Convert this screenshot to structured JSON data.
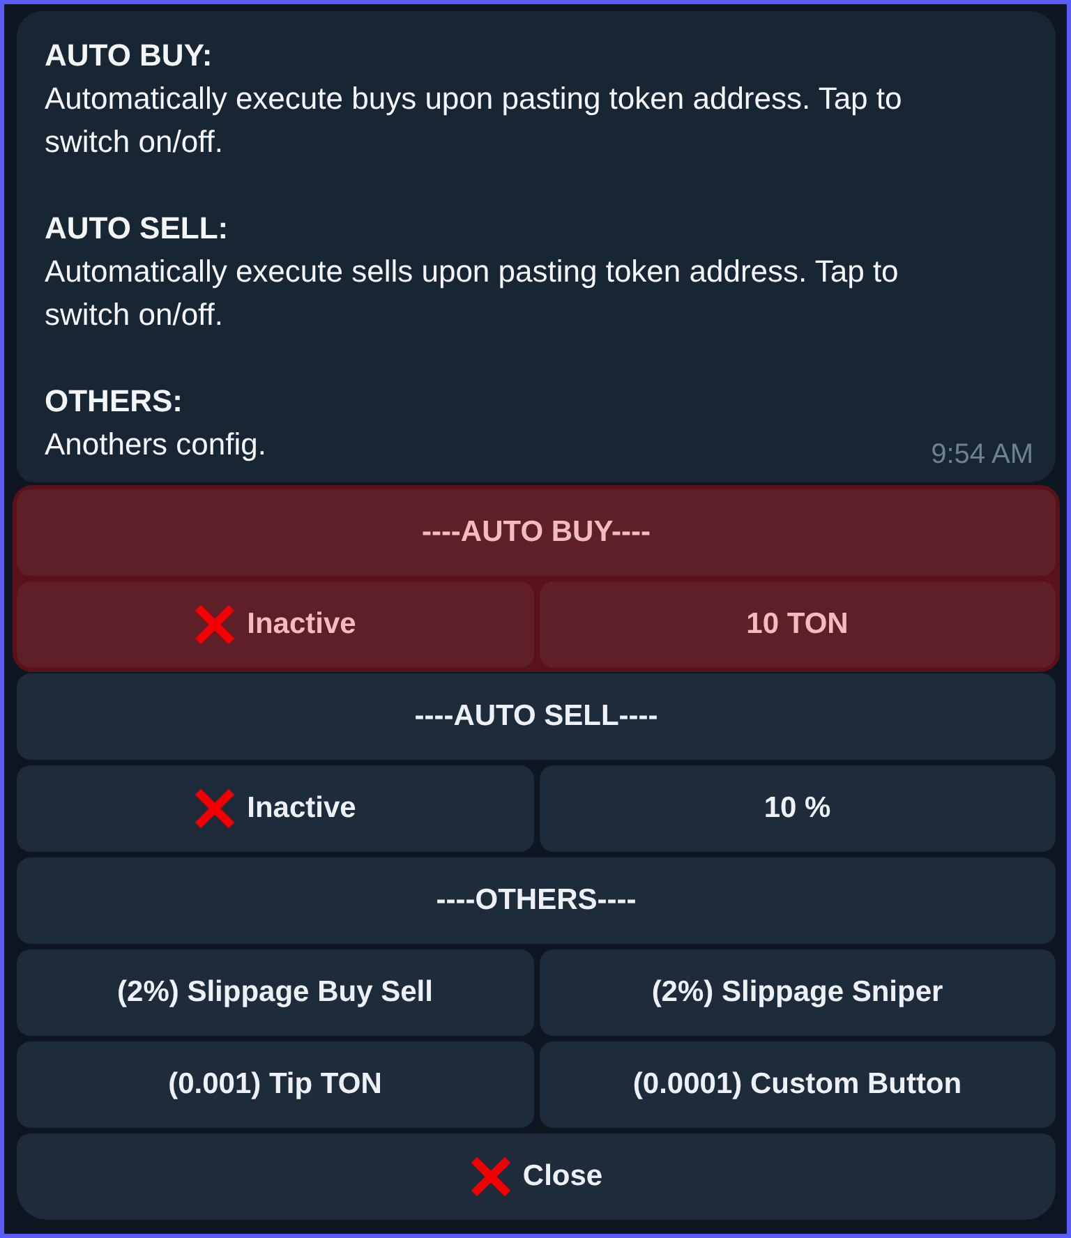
{
  "message": {
    "paragraphs": [
      {
        "heading": "AUTO BUY:",
        "body": "Automatically execute buys upon pasting token address. Tap to switch on/off."
      },
      {
        "heading": "AUTO SELL:",
        "body": "Automatically execute sells upon pasting token address. Tap to switch on/off."
      },
      {
        "heading": "OTHERS:",
        "body": "Anothers config."
      }
    ],
    "time": "9:54 AM"
  },
  "keyboard": {
    "sections": [
      {
        "highlighted": true,
        "rows": [
          [
            {
              "kind": "text",
              "label": "----AUTO BUY----"
            }
          ],
          [
            {
              "kind": "cross",
              "label": "Inactive"
            },
            {
              "kind": "text",
              "label": "10 TON"
            }
          ]
        ]
      },
      {
        "highlighted": false,
        "rows": [
          [
            {
              "kind": "text",
              "label": "----AUTO SELL----"
            }
          ],
          [
            {
              "kind": "cross",
              "label": "Inactive"
            },
            {
              "kind": "text",
              "label": "10 %"
            }
          ]
        ]
      },
      {
        "highlighted": false,
        "rows": [
          [
            {
              "kind": "text",
              "label": "----OTHERS----"
            }
          ],
          [
            {
              "kind": "text",
              "label": "(2%) Slippage Buy Sell"
            },
            {
              "kind": "text",
              "label": "(2%) Slippage Sniper"
            }
          ],
          [
            {
              "kind": "text",
              "label": "(0.001) Tip TON"
            },
            {
              "kind": "text",
              "label": "(0.0001) Custom Button"
            }
          ],
          [
            {
              "kind": "cross",
              "label": "Close"
            }
          ]
        ]
      }
    ]
  }
}
